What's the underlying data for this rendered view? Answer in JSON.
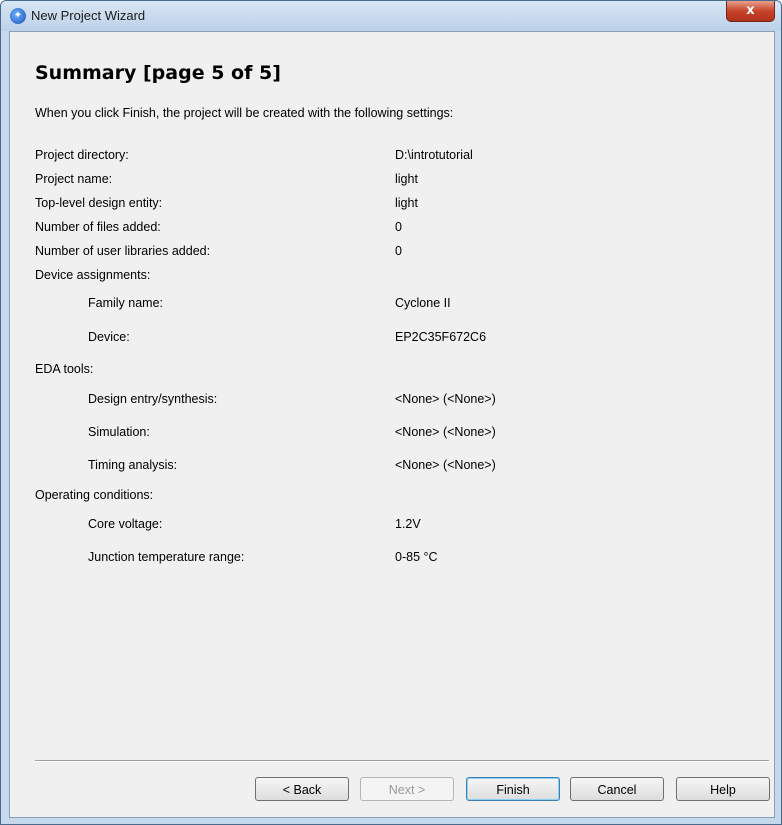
{
  "window": {
    "title": "New Project Wizard",
    "icon": "quartus-app-icon",
    "close_label": "x"
  },
  "page": {
    "heading": "Summary [page 5 of 5]",
    "intro": "When you click Finish, the project will be created with the following settings:"
  },
  "settings": [
    {
      "label": "Project directory:",
      "value": "D:\\introtutorial"
    },
    {
      "label": "Project name:",
      "value": "light"
    },
    {
      "label": "Top-level design entity:",
      "value": "light"
    },
    {
      "label": "Number of files added:",
      "value": "0"
    },
    {
      "label": "Number of user libraries added:",
      "value": "0"
    },
    {
      "label": "Device assignments:",
      "value": ""
    },
    {
      "label": "Family name:",
      "value": "Cyclone II"
    },
    {
      "label": "Device:",
      "value": "EP2C35F672C6"
    },
    {
      "label": "EDA tools:",
      "value": ""
    },
    {
      "label": "Design entry/synthesis:",
      "value": "<None> (<None>)"
    },
    {
      "label": "Simulation:",
      "value": "<None> (<None>)"
    },
    {
      "label": "Timing analysis:",
      "value": "<None> (<None>)"
    },
    {
      "label": "Operating conditions:",
      "value": ""
    },
    {
      "label": "Core voltage:",
      "value": "1.2V"
    },
    {
      "label": "Junction temperature range:",
      "value": "0-85 °C"
    }
  ],
  "buttons": {
    "back": "< Back",
    "next": "Next >",
    "finish": "Finish",
    "cancel": "Cancel",
    "help": "Help"
  }
}
